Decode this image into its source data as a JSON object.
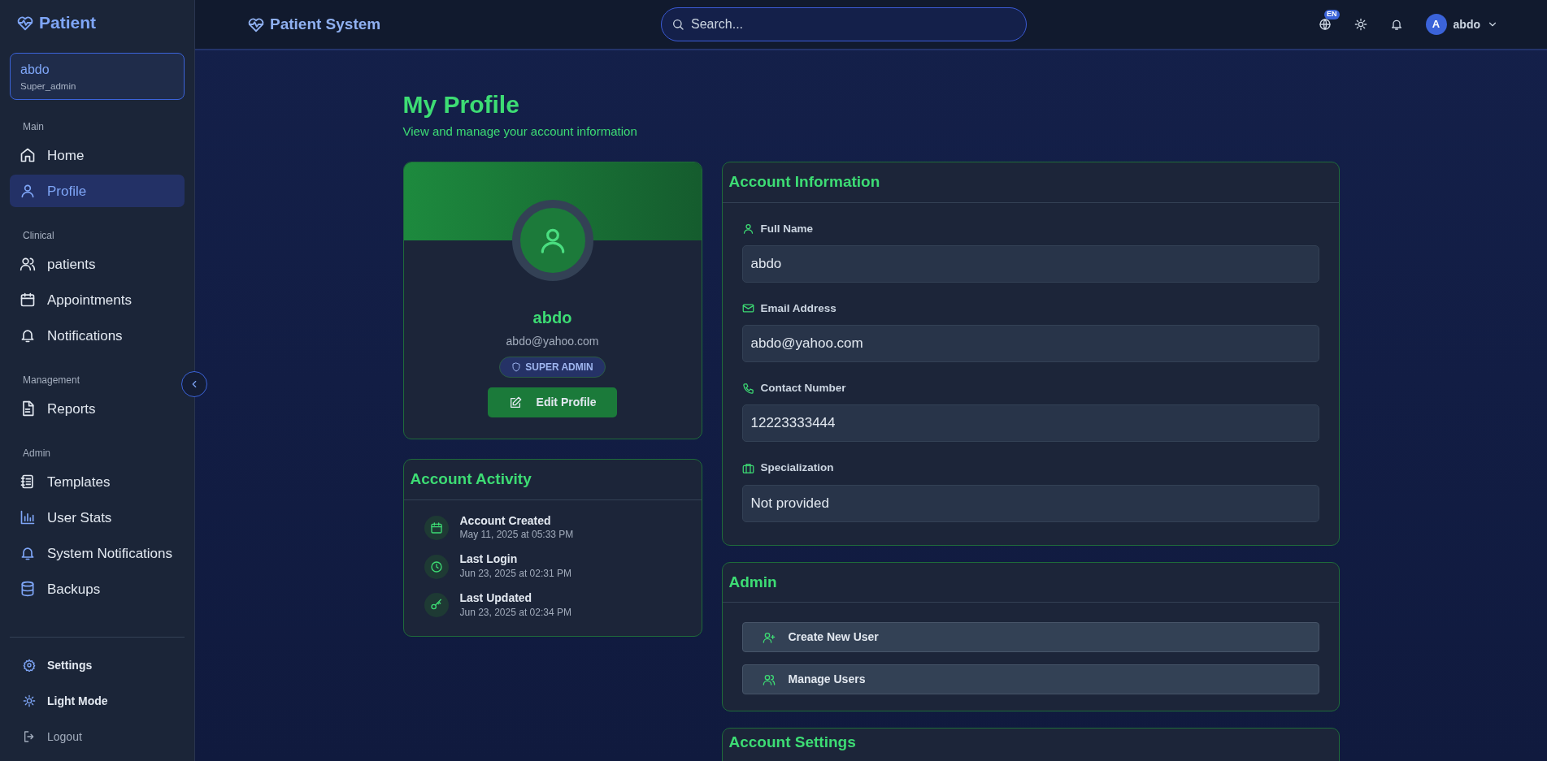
{
  "sidebar": {
    "brand": "Patient",
    "user": {
      "name": "abdo",
      "role": "Super_admin"
    },
    "sections": [
      {
        "title": "Main",
        "items": [
          {
            "label": "Home",
            "selected": false
          },
          {
            "label": "Profile",
            "selected": true
          }
        ]
      },
      {
        "title": "Clinical",
        "items": [
          {
            "label": "patients",
            "selected": false
          },
          {
            "label": "Appointments",
            "selected": false
          },
          {
            "label": "Notifications",
            "selected": false
          }
        ]
      },
      {
        "title": "Management",
        "items": [
          {
            "label": "Reports",
            "selected": false
          }
        ]
      },
      {
        "title": "Admin",
        "items": [
          {
            "label": "Templates",
            "selected": false
          },
          {
            "label": "User Stats",
            "selected": false
          },
          {
            "label": "System Notifications",
            "selected": false
          },
          {
            "label": "Backups",
            "selected": false
          }
        ]
      }
    ],
    "footer": [
      {
        "label": "Settings"
      },
      {
        "label": "Light Mode"
      },
      {
        "label": "Logout"
      }
    ]
  },
  "header": {
    "title": "Patient System",
    "search": {
      "placeholder": "Search..."
    },
    "language": "EN",
    "user": {
      "initial": "A",
      "name": "abdo"
    }
  },
  "page": {
    "title": "My Profile",
    "subtitle": "View and manage your account information"
  },
  "profile_card": {
    "name": "abdo",
    "email": "abdo@yahoo.com",
    "role": "SUPER ADMIN",
    "edit_button": "Edit Profile"
  },
  "activity": {
    "title": "Account Activity",
    "items": [
      {
        "title": "Account Created",
        "time": "May 11, 2025 at 05:33 PM"
      },
      {
        "title": "Last Login",
        "time": "Jun 23, 2025 at 02:31 PM"
      },
      {
        "title": "Last Updated",
        "time": "Jun 23, 2025 at 02:34 PM"
      }
    ]
  },
  "account_info": {
    "title": "Account Information",
    "fields": [
      {
        "label": "Full Name",
        "value": "abdo"
      },
      {
        "label": "Email Address",
        "value": "abdo@yahoo.com"
      },
      {
        "label": "Contact Number",
        "value": "12223333444"
      },
      {
        "label": "Specialization",
        "value": "Not provided"
      }
    ]
  },
  "admin": {
    "title": "Admin",
    "buttons": [
      {
        "label": "Create New User"
      },
      {
        "label": "Manage Users"
      }
    ]
  },
  "settings_card": {
    "title": "Account Settings"
  }
}
